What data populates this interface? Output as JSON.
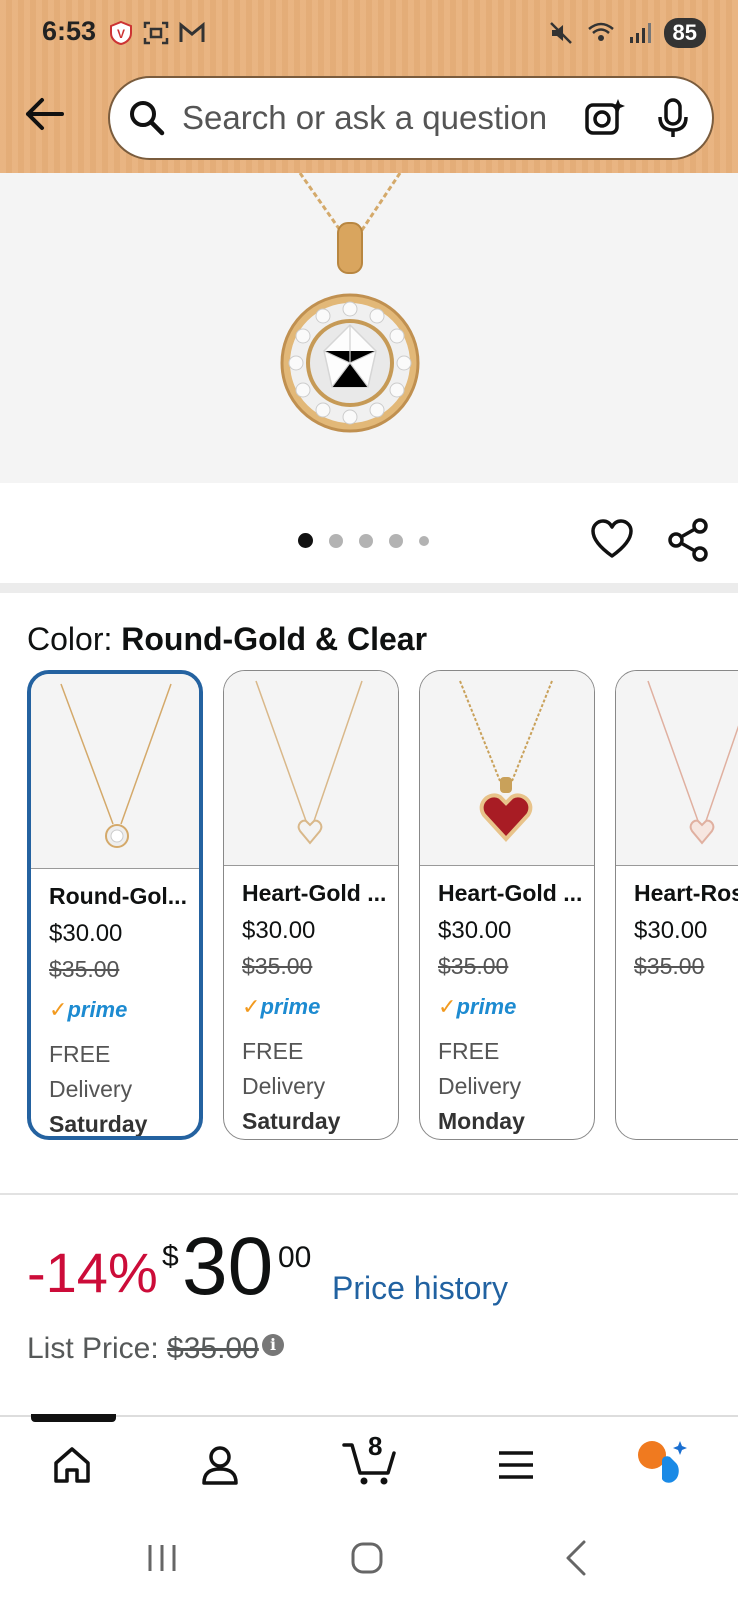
{
  "status_bar": {
    "time": "6:53",
    "battery": "85"
  },
  "search": {
    "placeholder": "Search or ask a question"
  },
  "gallery": {
    "dot_count": 5,
    "active_index": 0
  },
  "color_selector": {
    "label": "Color: ",
    "selected": "Round-Gold & Clear",
    "options": [
      {
        "name": "Round-Gol...",
        "price": "$30.00",
        "list_price": "$35.00",
        "prime": "prime",
        "delivery_label": "FREE Delivery",
        "delivery_day": "Saturday",
        "stone": "round-clear",
        "metal": "#d4a96a"
      },
      {
        "name": "Heart-Gold ...",
        "price": "$30.00",
        "list_price": "$35.00",
        "prime": "prime",
        "delivery_label": "FREE Delivery",
        "delivery_day": "Saturday",
        "stone": "heart-clear",
        "metal": "#d9b88a"
      },
      {
        "name": "Heart-Gold ...",
        "price": "$30.00",
        "list_price": "$35.00",
        "prime": "prime",
        "delivery_label": "FREE Delivery",
        "delivery_day": "Monday",
        "stone": "heart-red",
        "metal": "#c9a15a"
      },
      {
        "name": "Heart-Ros",
        "price": "$30.00",
        "list_price": "$35.00",
        "stone": "heart-rose",
        "metal": "#e0b0a0"
      }
    ]
  },
  "pricing": {
    "discount": "-14%",
    "currency": "$",
    "dollars": "30",
    "cents": "00",
    "price_history_link": "Price history",
    "list_price_label": "List Price: ",
    "list_price": "$35.00"
  },
  "bottom_nav": {
    "cart_count": "8",
    "items": [
      "home",
      "account",
      "cart",
      "menu",
      "rufus"
    ]
  },
  "colors": {
    "accent_red": "#cc0c39",
    "link_blue": "#2162a1",
    "selected_border": "#2462a0",
    "topbar": "#e8b07a"
  }
}
